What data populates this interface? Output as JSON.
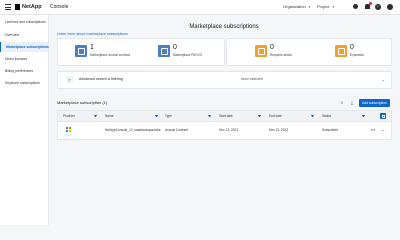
{
  "topbar": {
    "logo_text": "NetApp",
    "app_name": "Console",
    "organization_label": "Organization",
    "project_label": "Project",
    "help_glyph": "?"
  },
  "sidebar": {
    "items": [
      {
        "label": "Licenses and subscriptions"
      },
      {
        "label": "Overview"
      },
      {
        "label": "Marketplace subscriptions",
        "active": true
      },
      {
        "label": "Direct licenses"
      },
      {
        "label": "Billing preferences"
      },
      {
        "label": "Keystone subscriptions"
      }
    ]
  },
  "main": {
    "title": "Marketplace subscriptions",
    "learn_link": "Learn more about marketplace subscriptions",
    "stats": [
      {
        "value": "1",
        "caption": "Marketplace annual contract",
        "color": "#4d7fbf"
      },
      {
        "value": "0",
        "caption": "Marketplace PAYGO",
        "color": "#4d7fbf"
      },
      {
        "value": "0",
        "caption": "Requires action",
        "color": "#f0a030"
      },
      {
        "value": "0",
        "caption": "Expiration",
        "color": "#f0a030"
      }
    ],
    "filter": {
      "label": "Advanced search & filtering",
      "status": "None selected",
      "toggle_glyph": "»"
    },
    "table": {
      "title": "Marketplace subscription (1)",
      "add_button": "Add subscription",
      "columns": [
        "Provider",
        "Name",
        "Type",
        "Start date",
        "End date",
        "Status"
      ],
      "rows": [
        {
          "provider": "Microsoft Azure",
          "name": "NetAppConsole_12_saasbackupaddAe",
          "type": "Annual Contract",
          "start_date": "Dec 13, 2023",
          "end_date": "Dec 13, 2023",
          "status": "Subscribed"
        }
      ]
    }
  },
  "colors": {
    "accent": "#0b67c9",
    "stat_blue": "#4d7fbf",
    "stat_orange": "#f0a030"
  }
}
